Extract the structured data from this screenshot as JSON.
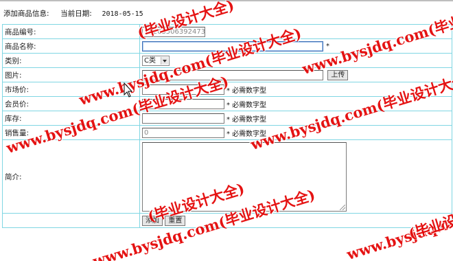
{
  "header": {
    "title": "添加商品信息:",
    "date_label": "当前日期:",
    "date_value": "2018-05-15"
  },
  "form": {
    "code_label": "商品编号:",
    "code_value": "15263506392473",
    "name_label": "商品名称:",
    "name_value": "",
    "required_mark": "*",
    "category_label": "类别:",
    "category_value": "C类",
    "image_label": "图片:",
    "upload_label": "上传",
    "market_price_label": "市场价:",
    "member_price_label": "会员价:",
    "stock_label": "库存:",
    "sales_label": "销售量:",
    "sales_value": "0",
    "numeric_hint": "* 必需数字型",
    "intro_label": "简介:",
    "add_label": "添加",
    "reset_label": "重置"
  },
  "watermark": {
    "text_a": "www.bysjdq.com(毕业设计大全)",
    "text_b": "(毕业设计大全)",
    "color": "#e30000"
  },
  "colors": {
    "table_border": "#7fd6e3",
    "watermark": "#e30000"
  }
}
